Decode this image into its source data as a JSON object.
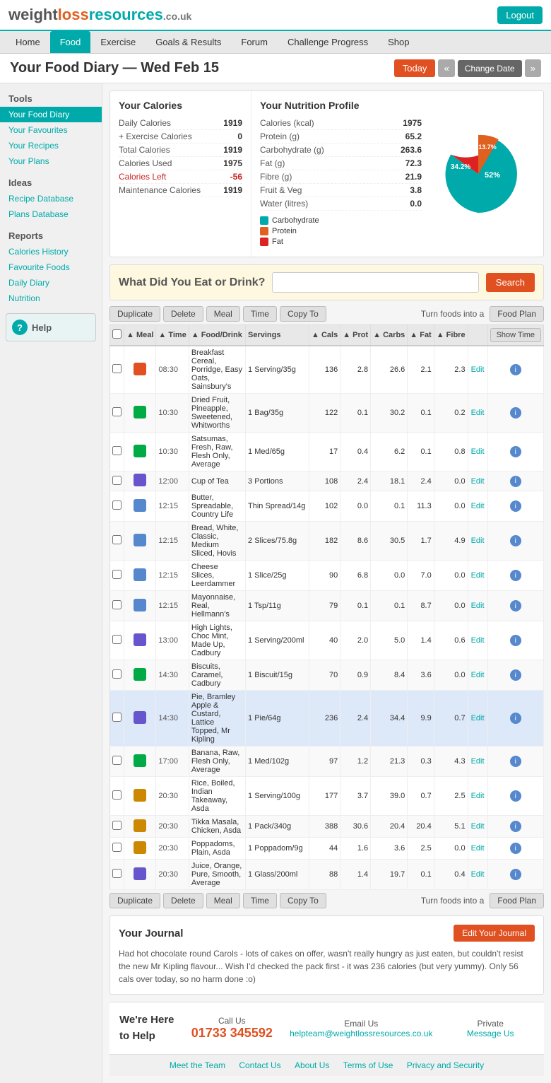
{
  "header": {
    "logo": {
      "weight": "weight",
      "loss": "loss",
      "resources": "resources",
      "couk": ".co.uk"
    },
    "logout_label": "Logout"
  },
  "nav": {
    "items": [
      {
        "label": "Home",
        "active": false
      },
      {
        "label": "Food",
        "active": true
      },
      {
        "label": "Exercise",
        "active": false
      },
      {
        "label": "Goals & Results",
        "active": false
      },
      {
        "label": "Forum",
        "active": false
      },
      {
        "label": "Challenge Progress",
        "active": false
      },
      {
        "label": "Shop",
        "active": false
      }
    ]
  },
  "page": {
    "title": "Your Food Diary — Wed Feb 15",
    "today_label": "Today",
    "prev_label": "«",
    "change_date_label": "Change Date",
    "next_label": "»"
  },
  "sidebar": {
    "tools_heading": "Tools",
    "tools_links": [
      {
        "label": "Your Food Diary",
        "active": true
      },
      {
        "label": "Your Favourites",
        "active": false
      },
      {
        "label": "Your Recipes",
        "active": false
      },
      {
        "label": "Your Plans",
        "active": false
      }
    ],
    "ideas_heading": "Ideas",
    "ideas_links": [
      {
        "label": "Recipe Database",
        "active": false
      },
      {
        "label": "Plans Database",
        "active": false
      }
    ],
    "reports_heading": "Reports",
    "reports_links": [
      {
        "label": "Calories History",
        "active": false
      },
      {
        "label": "Favourite Foods",
        "active": false
      },
      {
        "label": "Daily Diary",
        "active": false
      },
      {
        "label": "Nutrition",
        "active": false
      }
    ],
    "help_label": "Help"
  },
  "calories": {
    "title": "Your Calories",
    "rows": [
      {
        "label": "Daily Calories",
        "value": "1919"
      },
      {
        "label": "+ Exercise Calories",
        "value": "0"
      },
      {
        "label": "Total Calories",
        "value": "1919"
      },
      {
        "label": "Calories Used",
        "value": "1975"
      },
      {
        "label": "Calories Left",
        "value": "-56",
        "highlight": true
      },
      {
        "label": "Maintenance Calories",
        "value": "1919"
      }
    ]
  },
  "nutrition": {
    "title": "Your Nutrition Profile",
    "rows": [
      {
        "label": "Calories (kcal)",
        "value": "1975"
      },
      {
        "label": "Protein (g)",
        "value": "65.2"
      },
      {
        "label": "Carbohydrate (g)",
        "value": "263.6"
      },
      {
        "label": "Fat (g)",
        "value": "72.3"
      },
      {
        "label": "Fibre (g)",
        "value": "21.9"
      },
      {
        "label": "Fruit & Veg",
        "value": "3.8"
      },
      {
        "label": "Water (litres)",
        "value": "0.0"
      }
    ],
    "legend": [
      {
        "label": "Carbohydrate",
        "color": "#00aaaa"
      },
      {
        "label": "Protein",
        "color": "#e06020"
      },
      {
        "label": "Fat",
        "color": "#dd2222"
      }
    ],
    "chart": {
      "carb_pct": 52,
      "protein_pct": 13.7,
      "fat_pct": 34.2
    }
  },
  "search": {
    "label": "What Did You Eat or Drink?",
    "placeholder": "",
    "button_label": "Search"
  },
  "table_controls": {
    "duplicate": "Duplicate",
    "delete": "Delete",
    "meal": "Meal",
    "time": "Time",
    "copy_to": "Copy To",
    "turn_foods_into": "Turn foods into a",
    "food_plan": "Food Plan",
    "show_time": "Show Time"
  },
  "table_headers": [
    {
      "label": "▲ Meal"
    },
    {
      "label": "▲ Time"
    },
    {
      "label": "▲ Food/Drink"
    },
    {
      "label": "Servings"
    },
    {
      "label": "▲ Cals"
    },
    {
      "label": "▲ Prot"
    },
    {
      "label": "▲ Carbs"
    },
    {
      "label": "▲ Fat"
    },
    {
      "label": "▲ Fibre"
    },
    {
      "label": ""
    },
    {
      "label": ""
    }
  ],
  "food_rows": [
    {
      "icon_type": "breakfast",
      "time": "08:30",
      "food": "Breakfast Cereal, Porridge, Easy Oats, Sainsbury's",
      "servings": "1 Serving/35g",
      "cals": "136",
      "prot": "2.8",
      "carbs": "26.6",
      "fat": "2.1",
      "fibre": "2.3",
      "highlighted": false
    },
    {
      "icon_type": "snack",
      "time": "10:30",
      "food": "Dried Fruit, Pineapple, Sweetened, Whitworths",
      "servings": "1 Bag/35g",
      "cals": "122",
      "prot": "0.1",
      "carbs": "30.2",
      "fat": "0.1",
      "fibre": "0.2",
      "highlighted": false
    },
    {
      "icon_type": "snack",
      "time": "10:30",
      "food": "Satsumas, Fresh, Raw, Flesh Only, Average",
      "servings": "1 Med/65g",
      "cals": "17",
      "prot": "0.4",
      "carbs": "6.2",
      "fat": "0.1",
      "fibre": "0.8",
      "highlighted": false
    },
    {
      "icon_type": "drink",
      "time": "12:00",
      "food": "Cup of Tea",
      "servings": "3 Portions",
      "cals": "108",
      "prot": "2.4",
      "carbs": "18.1",
      "fat": "2.4",
      "fibre": "0.0",
      "highlighted": false
    },
    {
      "icon_type": "lunch",
      "time": "12:15",
      "food": "Butter, Spreadable, Country Life",
      "servings": "Thin Spread/14g",
      "cals": "102",
      "prot": "0.0",
      "carbs": "0.1",
      "fat": "11.3",
      "fibre": "0.0",
      "highlighted": false
    },
    {
      "icon_type": "lunch",
      "time": "12:15",
      "food": "Bread, White, Classic, Medium Sliced, Hovis",
      "servings": "2 Slices/75.8g",
      "cals": "182",
      "prot": "8.6",
      "carbs": "30.5",
      "fat": "1.7",
      "fibre": "4.9",
      "highlighted": false
    },
    {
      "icon_type": "lunch",
      "time": "12:15",
      "food": "Cheese Slices, Leerdammer",
      "servings": "1 Slice/25g",
      "cals": "90",
      "prot": "6.8",
      "carbs": "0.0",
      "fat": "7.0",
      "fibre": "0.0",
      "highlighted": false
    },
    {
      "icon_type": "lunch",
      "time": "12:15",
      "food": "Mayonnaise, Real, Hellmann's",
      "servings": "1 Tsp/11g",
      "cals": "79",
      "prot": "0.1",
      "carbs": "0.1",
      "fat": "8.7",
      "fibre": "0.0",
      "highlighted": false
    },
    {
      "icon_type": "drink",
      "time": "13:00",
      "food": "High Lights, Choc Mint, Made Up, Cadbury",
      "servings": "1 Serving/200ml",
      "cals": "40",
      "prot": "2.0",
      "carbs": "5.0",
      "fat": "1.4",
      "fibre": "0.6",
      "highlighted": false
    },
    {
      "icon_type": "snack",
      "time": "14:30",
      "food": "Biscuits, Caramel, Cadbury",
      "servings": "1 Biscuit/15g",
      "cals": "70",
      "prot": "0.9",
      "carbs": "8.4",
      "fat": "3.6",
      "fibre": "0.0",
      "highlighted": false
    },
    {
      "icon_type": "drink",
      "time": "14:30",
      "food": "Pie, Bramley Apple & Custard, Lattice Topped, Mr Kipling",
      "servings": "1 Pie/64g",
      "cals": "236",
      "prot": "2.4",
      "carbs": "34.4",
      "fat": "9.9",
      "fibre": "0.7",
      "highlighted": true
    },
    {
      "icon_type": "snack",
      "time": "17:00",
      "food": "Banana, Raw, Flesh Only, Average",
      "servings": "1 Med/102g",
      "cals": "97",
      "prot": "1.2",
      "carbs": "21.3",
      "fat": "0.3",
      "fibre": "4.3",
      "highlighted": false
    },
    {
      "icon_type": "dinner",
      "time": "20:30",
      "food": "Rice, Boiled, Indian Takeaway, Asda",
      "servings": "1 Serving/100g",
      "cals": "177",
      "prot": "3.7",
      "carbs": "39.0",
      "fat": "0.7",
      "fibre": "2.5",
      "highlighted": false
    },
    {
      "icon_type": "dinner",
      "time": "20:30",
      "food": "Tikka Masala, Chicken, Asda",
      "servings": "1 Pack/340g",
      "cals": "388",
      "prot": "30.6",
      "carbs": "20.4",
      "fat": "20.4",
      "fibre": "5.1",
      "highlighted": false
    },
    {
      "icon_type": "dinner",
      "time": "20:30",
      "food": "Poppadoms, Plain, Asda",
      "servings": "1 Poppadom/9g",
      "cals": "44",
      "prot": "1.6",
      "carbs": "3.6",
      "fat": "2.5",
      "fibre": "0.0",
      "highlighted": false
    },
    {
      "icon_type": "drink",
      "time": "20:30",
      "food": "Juice, Orange, Pure, Smooth, Average",
      "servings": "1 Glass/200ml",
      "cals": "88",
      "prot": "1.4",
      "carbs": "19.7",
      "fat": "0.1",
      "fibre": "0.4",
      "highlighted": false
    }
  ],
  "journal": {
    "title": "Your Journal",
    "edit_label": "Edit Your Journal",
    "text": "Had hot chocolate round Carols - lots of cakes on offer, wasn't really hungry as just eaten, but couldn't resist the new Mr Kipling flavour... Wish I'd checked the pack first - it was 236 calories (but very yummy). Only 56 cals over today, so no harm done :o)"
  },
  "footer_help": {
    "title": "We're Here\nto Help",
    "call_label": "Call Us",
    "phone": "01733 345592",
    "email_label": "Email Us",
    "email": "helpteam@weightlossresources.co.uk",
    "private_label": "Private",
    "message_label": "Message Us"
  },
  "bottom_links": [
    {
      "label": "Meet the Team"
    },
    {
      "label": "Contact Us"
    },
    {
      "label": "About Us"
    },
    {
      "label": "Terms of Use"
    },
    {
      "label": "Privacy and Security"
    }
  ]
}
